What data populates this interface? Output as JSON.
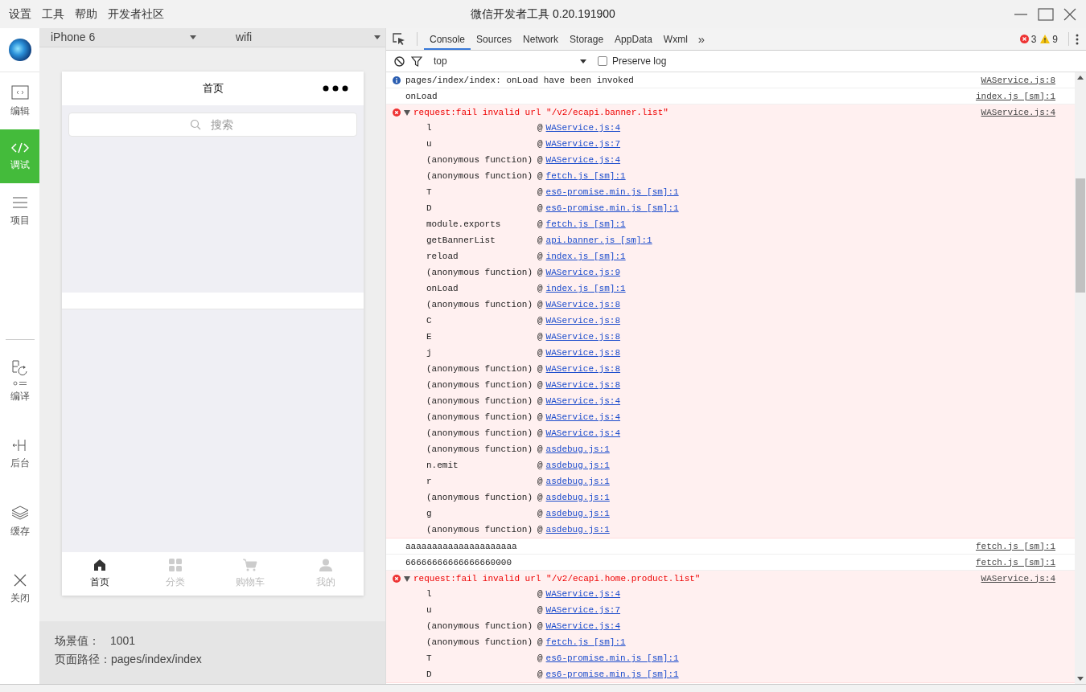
{
  "menu": [
    "设置",
    "工具",
    "帮助",
    "开发者社区"
  ],
  "window": {
    "title": "微信开发者工具 0.20.191900"
  },
  "sidebar": {
    "items": [
      {
        "label": "编辑",
        "kind": "editor",
        "selected": false
      },
      {
        "label": "调试",
        "kind": "debug",
        "selected": true
      },
      {
        "label": "项目",
        "kind": "project",
        "selected": false
      },
      {
        "label": "编译",
        "kind": "compile",
        "selected": false
      },
      {
        "label": "后台",
        "kind": "background",
        "selected": false
      },
      {
        "label": "缓存",
        "kind": "cache",
        "selected": false
      },
      {
        "label": "关闭",
        "kind": "close",
        "selected": false
      }
    ]
  },
  "simulator": {
    "device": "iPhone 6",
    "network": "wifi",
    "page": {
      "title": "首页",
      "search": {
        "placeholder": "搜索"
      },
      "tabs": [
        {
          "label": "首页",
          "kind": "home",
          "selected": true
        },
        {
          "label": "分类",
          "kind": "category",
          "selected": false
        },
        {
          "label": "购物车",
          "kind": "cart",
          "selected": false
        },
        {
          "label": "我的",
          "kind": "user",
          "selected": false
        }
      ]
    },
    "info": [
      {
        "label": "场景值：",
        "value": "1001"
      },
      {
        "label": "页面路径：",
        "value": "pages/index/index"
      }
    ]
  },
  "devtools": {
    "tabs": [
      {
        "label": "Console",
        "selected": true
      },
      {
        "label": "Sources",
        "selected": false
      },
      {
        "label": "Network",
        "selected": false
      },
      {
        "label": "Storage",
        "selected": false
      },
      {
        "label": "AppData",
        "selected": false
      },
      {
        "label": "Wxml",
        "selected": false
      }
    ],
    "more": "»",
    "errors": "3",
    "warnings": "9",
    "filter": {
      "context": "top",
      "preserve_log": {
        "label": "Preserve log",
        "checked": false
      }
    },
    "log": [
      {
        "kind": "info",
        "text": "pages/index/index: onLoad have been invoked",
        "source": "WAService.js:8"
      },
      {
        "kind": "log",
        "text": "onLoad",
        "source": "index.js [sm]:1"
      },
      {
        "kind": "error",
        "expanded": true,
        "text": "request:fail invalid url \"/v2/ecapi.banner.list\"",
        "source": "WAService.js:4",
        "frames": [
          {
            "function": "l",
            "at": "@",
            "location": "WAService.js:4"
          },
          {
            "function": "u",
            "at": "@",
            "location": "WAService.js:7"
          },
          {
            "function": "(anonymous function)",
            "at": "@",
            "location": "WAService.js:4"
          },
          {
            "function": "(anonymous function)",
            "at": "@",
            "location": "fetch.js [sm]:1"
          },
          {
            "function": "T",
            "at": "@",
            "location": "es6-promise.min.js [sm]:1"
          },
          {
            "function": "D",
            "at": "@",
            "location": "es6-promise.min.js [sm]:1"
          },
          {
            "function": "module.exports",
            "at": "@",
            "location": "fetch.js [sm]:1"
          },
          {
            "function": "getBannerList",
            "at": "@",
            "location": "api.banner.js [sm]:1"
          },
          {
            "function": "reload",
            "at": "@",
            "location": "index.js [sm]:1"
          },
          {
            "function": "(anonymous function)",
            "at": "@",
            "location": "WAService.js:9"
          },
          {
            "function": "onLoad",
            "at": "@",
            "location": "index.js [sm]:1"
          },
          {
            "function": "(anonymous function)",
            "at": "@",
            "location": "WAService.js:8"
          },
          {
            "function": "C",
            "at": "@",
            "location": "WAService.js:8"
          },
          {
            "function": "E",
            "at": "@",
            "location": "WAService.js:8"
          },
          {
            "function": "j",
            "at": "@",
            "location": "WAService.js:8"
          },
          {
            "function": "(anonymous function)",
            "at": "@",
            "location": "WAService.js:8"
          },
          {
            "function": "(anonymous function)",
            "at": "@",
            "location": "WAService.js:8"
          },
          {
            "function": "(anonymous function)",
            "at": "@",
            "location": "WAService.js:4"
          },
          {
            "function": "(anonymous function)",
            "at": "@",
            "location": "WAService.js:4"
          },
          {
            "function": "(anonymous function)",
            "at": "@",
            "location": "WAService.js:4"
          },
          {
            "function": "(anonymous function)",
            "at": "@",
            "location": "asdebug.js:1"
          },
          {
            "function": "n.emit",
            "at": "@",
            "location": "asdebug.js:1"
          },
          {
            "function": "r",
            "at": "@",
            "location": "asdebug.js:1"
          },
          {
            "function": "(anonymous function)",
            "at": "@",
            "location": "asdebug.js:1"
          },
          {
            "function": "g",
            "at": "@",
            "location": "asdebug.js:1"
          },
          {
            "function": "(anonymous function)",
            "at": "@",
            "location": "asdebug.js:1"
          }
        ]
      },
      {
        "kind": "log",
        "text": "aaaaaaaaaaaaaaaaaaaaa",
        "source": "fetch.js [sm]:1"
      },
      {
        "kind": "log",
        "text": "66666666666666660000",
        "source": "fetch.js [sm]:1"
      },
      {
        "kind": "error",
        "expanded": true,
        "text": "request:fail invalid url \"/v2/ecapi.home.product.list\"",
        "source": "WAService.js:4",
        "frames": [
          {
            "function": "l",
            "at": "@",
            "location": "WAService.js:4"
          },
          {
            "function": "u",
            "at": "@",
            "location": "WAService.js:7"
          },
          {
            "function": "(anonymous function)",
            "at": "@",
            "location": "WAService.js:4"
          },
          {
            "function": "(anonymous function)",
            "at": "@",
            "location": "fetch.js [sm]:1"
          },
          {
            "function": "T",
            "at": "@",
            "location": "es6-promise.min.js [sm]:1"
          },
          {
            "function": "D",
            "at": "@",
            "location": "es6-promise.min.js [sm]:1"
          }
        ]
      }
    ]
  }
}
